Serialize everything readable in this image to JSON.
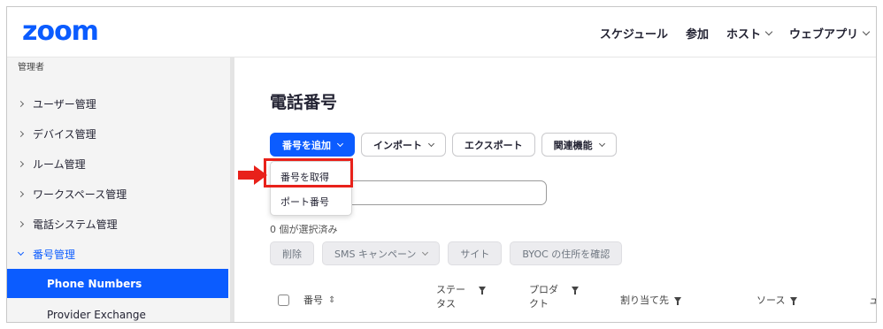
{
  "logo": "zoom",
  "topnav": {
    "schedule": "スケジュール",
    "join": "参加",
    "host": "ホスト",
    "webapp": "ウェブアプリ"
  },
  "sidebar": {
    "section": "管理者",
    "items": [
      {
        "label": "ユーザー管理"
      },
      {
        "label": "デバイス管理"
      },
      {
        "label": "ルーム管理"
      },
      {
        "label": "ワークスペース管理"
      },
      {
        "label": "電話システム管理"
      },
      {
        "label": "番号管理"
      }
    ],
    "subitems": [
      {
        "label": "Phone Numbers"
      },
      {
        "label": "Provider Exchange"
      }
    ]
  },
  "main": {
    "title": "電話番号",
    "buttons": {
      "add_number": "番号を追加",
      "import": "インポート",
      "export": "エクスポート",
      "related": "関連機能"
    },
    "dropdown": {
      "get_number": "番号を取得",
      "port_number": "ポート番号"
    },
    "selected_count": "0 個が選択済み",
    "actions": {
      "delete": "削除",
      "sms_campaign": "SMS キャンペーン",
      "site": "サイト",
      "byoc": "BYOC の住所を確認"
    },
    "table": {
      "number": "番号",
      "status": "ステータス",
      "product": "プロダクト",
      "assigned_to": "割り当て先",
      "source": "ソース",
      "extra": "ュ"
    }
  },
  "colors": {
    "accent": "#0b5cff",
    "highlight": "#e8211a"
  }
}
